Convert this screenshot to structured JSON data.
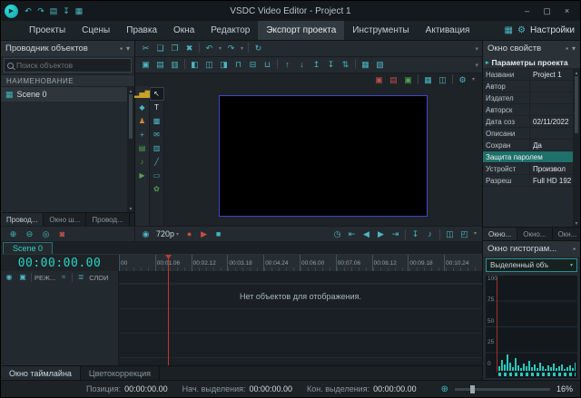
{
  "titlebar": {
    "title": "VSDC Video Editor - Project 1",
    "logo_glyph": "▶",
    "quick_icons": [
      {
        "name": "undo-quick-icon",
        "glyph": "↶"
      },
      {
        "name": "redo-quick-icon",
        "glyph": "↷"
      },
      {
        "name": "save-quick-icon",
        "glyph": "▤"
      },
      {
        "name": "export-quick-icon",
        "glyph": "↧"
      },
      {
        "name": "scene-quick-icon",
        "glyph": "▦"
      }
    ],
    "window_buttons": [
      {
        "name": "minimize-button",
        "glyph": "–"
      },
      {
        "name": "maximize-button",
        "glyph": "▢"
      },
      {
        "name": "close-button",
        "glyph": "×"
      }
    ]
  },
  "menubar": {
    "items": [
      {
        "label": "Проекты"
      },
      {
        "label": "Сцены"
      },
      {
        "label": "Правка"
      },
      {
        "label": "Окна"
      },
      {
        "label": "Редактор"
      },
      {
        "label": "Экспорт проекта",
        "cls": "active"
      },
      {
        "label": "Инструменты"
      },
      {
        "label": "Активация"
      }
    ],
    "layout_icon": "▦",
    "gear_icon": "⚙",
    "settings_label": "Настройки"
  },
  "explorer": {
    "title": "Проводник объектов",
    "pin_icon": "▪",
    "collapse_icon": "▾",
    "search_placeholder": "Поиск объектов",
    "column_header": "НАИМЕНОВАНИЕ",
    "items": [
      {
        "icon": "▦",
        "label": "Scene 0"
      }
    ],
    "tabs": [
      {
        "label": "Провод...",
        "cls": "active"
      },
      {
        "label": "Окно ш..."
      },
      {
        "label": "Провод..."
      }
    ]
  },
  "toolbar_row1": [
    {
      "name": "cut-icon",
      "glyph": "✂"
    },
    {
      "name": "copy-icon",
      "glyph": "❏"
    },
    {
      "name": "paste-icon",
      "glyph": "❐"
    },
    {
      "name": "delete-icon",
      "glyph": "✖"
    },
    {
      "name": "separator",
      "glyph": "",
      "cls": "sep"
    },
    {
      "name": "undo-icon",
      "glyph": "↶"
    },
    {
      "name": "undo-caret-icon",
      "glyph": "▾",
      "cls": "caret"
    },
    {
      "name": "redo-icon",
      "glyph": "↷"
    },
    {
      "name": "redo-caret-icon",
      "glyph": "▾",
      "cls": "caret"
    },
    {
      "name": "separator",
      "glyph": "",
      "cls": "sep"
    },
    {
      "name": "refresh-icon",
      "glyph": "↻"
    }
  ],
  "toolbar_row2": [
    {
      "name": "add-object-icon",
      "glyph": "▣"
    },
    {
      "name": "add-image-icon",
      "glyph": "▤"
    },
    {
      "name": "add-slide-icon",
      "glyph": "▥"
    },
    {
      "name": "separator",
      "glyph": "",
      "cls": "sep"
    },
    {
      "name": "align-left-icon",
      "glyph": "◧"
    },
    {
      "name": "align-center-icon",
      "glyph": "◫"
    },
    {
      "name": "align-right-icon",
      "glyph": "◨"
    },
    {
      "name": "align-top-icon",
      "glyph": "⊓"
    },
    {
      "name": "align-middle-icon",
      "glyph": "⊟"
    },
    {
      "name": "align-bottom-icon",
      "glyph": "⊔"
    },
    {
      "name": "separator",
      "glyph": "",
      "cls": "sep"
    },
    {
      "name": "move-up-icon",
      "glyph": "↑"
    },
    {
      "name": "move-down-icon",
      "glyph": "↓"
    },
    {
      "name": "bring-front-icon",
      "glyph": "↥"
    },
    {
      "name": "send-back-icon",
      "glyph": "↧"
    },
    {
      "name": "swap-order-icon",
      "glyph": "⇅"
    },
    {
      "name": "separator",
      "glyph": "",
      "cls": "sep"
    },
    {
      "name": "group-icon",
      "glyph": "▦"
    },
    {
      "name": "ungroup-icon",
      "glyph": "▧"
    }
  ],
  "toolbar_row3": [
    {
      "name": "mask-icon",
      "glyph": "▣",
      "color": "#c0504d"
    },
    {
      "name": "chroma-key-icon",
      "glyph": "▤",
      "color": "#c0504d"
    },
    {
      "name": "filters-icon",
      "glyph": "▣",
      "color": "#55a055"
    },
    {
      "name": "separator",
      "glyph": "",
      "cls": "sep"
    },
    {
      "name": "grid-view-icon",
      "glyph": "▦"
    },
    {
      "name": "safe-zones-icon",
      "glyph": "◫"
    },
    {
      "name": "separator",
      "glyph": "",
      "cls": "sep"
    },
    {
      "name": "view-settings-gear-icon",
      "glyph": "⚙"
    },
    {
      "name": "view-settings-caret-icon",
      "glyph": "▾",
      "cls": "caret"
    }
  ],
  "vtool_primary": [
    {
      "name": "add-chart-icon",
      "glyph": "▂▅▇",
      "color": "#c9a227"
    },
    {
      "name": "add-effect-icon",
      "glyph": "◆",
      "color": "#4db6c4"
    },
    {
      "name": "add-motion-icon",
      "glyph": "♟",
      "color": "#cf8a3c"
    },
    {
      "name": "movement-icon",
      "glyph": "+",
      "color": "#3fb9c0"
    },
    {
      "name": "add-video-icon",
      "glyph": "▤",
      "color": "#55a055"
    },
    {
      "name": "add-audio-icon",
      "glyph": "♪",
      "color": "#55a055"
    },
    {
      "name": "play-scene-icon",
      "glyph": "▶",
      "color": "#55a055"
    }
  ],
  "vtool_secondary": [
    {
      "name": "cursor-icon",
      "glyph": "↖",
      "color": "#e0e8eb",
      "cls": "sel"
    },
    {
      "name": "text-tool-icon",
      "glyph": "T",
      "color": "#e0e8eb"
    },
    {
      "name": "sprite-tool-icon",
      "glyph": "▩",
      "color": "#4db6c4"
    },
    {
      "name": "tooltip-tool-icon",
      "glyph": "✉",
      "color": "#4db6c4"
    },
    {
      "name": "chart-tool-icon",
      "glyph": "▥",
      "color": "#4db6c4"
    },
    {
      "name": "line-tool-icon",
      "glyph": "╱",
      "color": "#3fb9c0"
    },
    {
      "name": "rectangle-tool-icon",
      "glyph": "▭",
      "color": "#3fb9c0"
    },
    {
      "name": "shape-tool-icon",
      "glyph": "✿",
      "color": "#55a055"
    }
  ],
  "playback": {
    "left_icons": [
      {
        "name": "zoom-in-icon",
        "glyph": "⊕",
        "color": "#3fb9c0"
      },
      {
        "name": "zoom-out-icon",
        "glyph": "⊖",
        "color": "#3fb9c0"
      },
      {
        "name": "zoom-reset-icon",
        "glyph": "◎",
        "color": "#3fb9c0"
      },
      {
        "name": "record-desktop-icon",
        "glyph": "◙",
        "color": "#c0504d"
      }
    ],
    "eye_icon": "◉",
    "quality": "720p",
    "transport_icons": [
      {
        "name": "record-icon",
        "glyph": "●",
        "color": "#cf4a3f"
      },
      {
        "name": "play-icon",
        "glyph": "▶",
        "color": "#cf4a3f"
      },
      {
        "name": "stop-icon",
        "glyph": "■",
        "color": "#3fb9c0"
      }
    ],
    "right_icons": [
      {
        "name": "clock-icon",
        "glyph": "◷"
      },
      {
        "name": "go-start-icon",
        "glyph": "⇤"
      },
      {
        "name": "prev-frame-icon",
        "glyph": "◀"
      },
      {
        "name": "next-frame-icon",
        "glyph": "▶"
      },
      {
        "name": "go-end-icon",
        "glyph": "⇥"
      },
      {
        "name": "separator",
        "glyph": "",
        "cls": "sep"
      },
      {
        "name": "capture-frame-icon",
        "glyph": "↧"
      },
      {
        "name": "audio-wave-icon",
        "glyph": "♪"
      },
      {
        "name": "separator",
        "glyph": "",
        "cls": "sep"
      },
      {
        "name": "dock-preview-icon",
        "glyph": "◫"
      },
      {
        "name": "expand-preview-icon",
        "glyph": "◰"
      },
      {
        "name": "playback-overflow-icon",
        "glyph": "▾",
        "cls": "caret"
      }
    ]
  },
  "timeline": {
    "scene_tab": "Scene 0",
    "time_display": "00:00:00.00",
    "ruler_ticks": [
      {
        "label": "00"
      },
      {
        "label": "00:01.06"
      },
      {
        "label": "00:02.12"
      },
      {
        "label": "00:03.18"
      },
      {
        "label": "00:04.24"
      },
      {
        "label": "00:06.00"
      },
      {
        "label": "00:07.06"
      },
      {
        "label": "00:08.12"
      },
      {
        "label": "00:09.18"
      },
      {
        "label": "00:10.24"
      }
    ],
    "eye_icon": "◉",
    "lock_icon": "▣",
    "mode_label": "РЕЖ...",
    "wave_icon": "≈",
    "layers_icon": "≣",
    "layers_label": "СЛОИ",
    "empty_message": "Нет объектов для отображения.",
    "bottom_tabs": [
      {
        "label": "Окно таймлайна",
        "cls": "active"
      },
      {
        "label": "Цветокоррекция"
      }
    ]
  },
  "properties": {
    "title": "Окно свойств",
    "pin_icon": "▪",
    "collapse_icon": "▾",
    "group_label": "Параметры проекта",
    "rows": [
      {
        "label": "Названи",
        "value": "Project 1"
      },
      {
        "label": "Автор",
        "value": ""
      },
      {
        "label": "Издател",
        "value": ""
      },
      {
        "label": "Авторск",
        "value": ""
      },
      {
        "label": "Дата соз",
        "value": "02/11/2022"
      },
      {
        "label": "Описани",
        "value": ""
      },
      {
        "label": "Сохран",
        "value": "Да"
      },
      {
        "label": "Защита паролем",
        "value": "",
        "cls": "accent"
      },
      {
        "label": "Устройст",
        "value": "Произвол"
      },
      {
        "label": "Разреш",
        "value": "Full HD 192"
      }
    ],
    "tabs": [
      {
        "label": "Окно...",
        "cls": "active"
      },
      {
        "label": "Окно..."
      },
      {
        "label": "Окн..."
      }
    ]
  },
  "histogram": {
    "title": "Окно гистограм...",
    "pin_icon": "▪",
    "dropdown_value": "Выделенный объ",
    "dropdown_arrow": "▾",
    "axis_ticks": [
      {
        "label": "100"
      },
      {
        "label": "75"
      },
      {
        "label": "50"
      },
      {
        "label": "25"
      },
      {
        "label": "0"
      }
    ],
    "bars": [
      5,
      12,
      7,
      18,
      9,
      4,
      14,
      6,
      3,
      8,
      5,
      11,
      4,
      7,
      3,
      9,
      5,
      2,
      6,
      4,
      8,
      3,
      5,
      7,
      2,
      4,
      6,
      3,
      9,
      4,
      2,
      5,
      3,
      7,
      4,
      2,
      6,
      3,
      4,
      2
    ]
  },
  "statusbar": {
    "fields": [
      {
        "label": "Позиция:",
        "value": "00:00:00.00"
      },
      {
        "label": "Нач. выделения:",
        "value": "00:00:00.00"
      },
      {
        "label": "Кон. выделения:",
        "value": "00:00:00.00"
      }
    ],
    "zoom_icon": "⊕",
    "zoom_value": "16%"
  }
}
